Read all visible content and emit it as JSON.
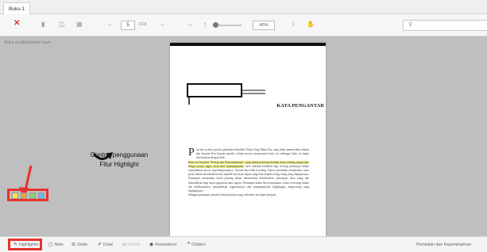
{
  "tab": {
    "title": "Buku 1"
  },
  "toolbar": {
    "page_current": "5",
    "page_total": "/318",
    "zoom": "40%",
    "search_icon": "search-icon"
  },
  "viewer": {
    "notice": "Buku ini dipinjamkan Iwan",
    "page": {
      "heading": "KATA PENGANTAR",
      "dropcap": "P",
      "para1": "uji dan syukur penulis panjatkan kehadirat Tuhan Yang Maha Esa, yang telah memberikan rahmat dan karunia-Nya kepada penulis selama proses penyusunan buku ini sehingga buku ini dapat diselesaikan dengan baik.",
      "para2_highlight": "Buku ini berjudul \"Prinsip dan Kepemimpinan\", yang memuat konsep-konsep dasar tentang pengertian, fungsi, peran, tugas, serta teori kepemimpinan,",
      "para2_rest": " serta tindakan-tindakan bagi seorang pemimpin dalam menjalankan proses kepemimpinannya. Sejarah kita telah berulang, bahwa pemimpin memainkan suatu peran dalam memberikan nilai tambah dan masa depan yang baik kepada orang-orang yang dipimpinnya. Pemimpin merupakan tokoh penting dalam menentukan keberhasilan, kemajuan, daya saing dan kemandirian bagi suatu organisasi atau negara. Pemimpin dalam hal menentukan, selain seseorang dalam diri kehebatannya, menjalankan organisasinya dan mempengaruhi lingkungan orang-orang yang dipimpinnya.",
      "para3": "Sebagai pemimpin, penulis berharap buku yang sederhana ini dapat menjadi..."
    }
  },
  "annotation": {
    "line1": "Contoh penggunaan",
    "line2": "Fitur Highlight"
  },
  "swatches": [
    "#f2e84a",
    "#f0a040",
    "#8dd07a",
    "#6fb8f0"
  ],
  "bottom": {
    "highlighter": "Highlighter",
    "note": "Note",
    "strike": "Strike",
    "draw": "Draw",
    "delete": "Delete",
    "annotations": "Annotations",
    "citation": "Citation",
    "book_title": "Pemimpin dan Kepemimpinan"
  },
  "accent": "#e8322c"
}
